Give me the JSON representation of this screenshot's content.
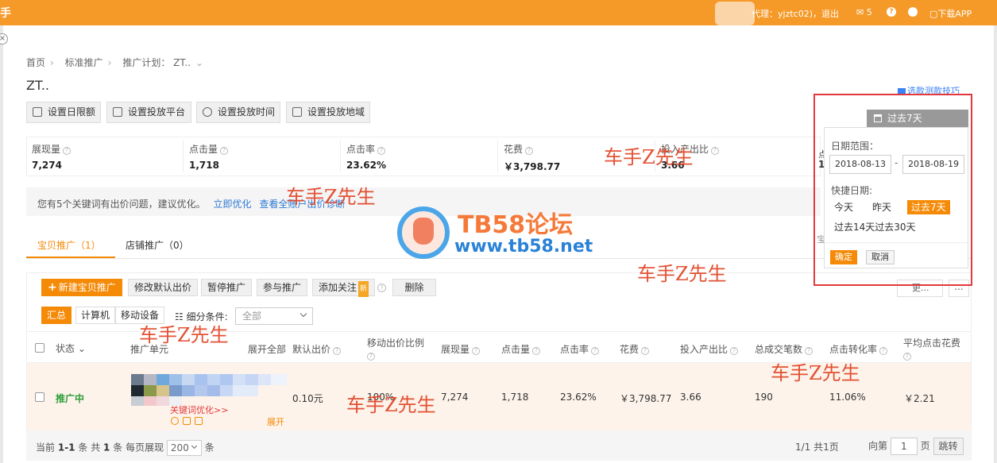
{
  "topbar": {
    "logo_char": "手",
    "agent_text": "代理：yjztc02)，退出",
    "messages": "✉ 5",
    "help": "?",
    "download": "▢下载APP"
  },
  "breadcrumb": [
    "首页",
    "标准推广",
    "推广计划： ZT.."
  ],
  "plan_title": "ZT..",
  "tips_link": "选款测款技巧",
  "settings_buttons": [
    "设置日限额",
    "设置投放平台",
    "设置投放时间",
    "设置投放地域"
  ],
  "stats": [
    {
      "label": "展现量",
      "value": "7,274"
    },
    {
      "label": "点击量",
      "value": "1,718"
    },
    {
      "label": "点击率",
      "value": "23.62%"
    },
    {
      "label": "花费",
      "value": "￥3,798.77"
    },
    {
      "label": "投入产出比",
      "value": "3.66"
    }
  ],
  "stat_behind": {
    "label": "点",
    "value": "1"
  },
  "notice": {
    "text": "您有5个关键词有出价问题，建议优化。",
    "link1": "立即优化",
    "link2": "查看全账户出价诊断"
  },
  "tabs": [
    "宝贝推广（1）",
    "店铺推广（0）"
  ],
  "toolbar": {
    "new": "新建宝贝推广",
    "buttons": [
      "修改默认出价",
      "暂停推广",
      "参与推广",
      "添加关注"
    ],
    "new_badge": "新",
    "delete": "删除",
    "more": "更...",
    "dots": "..."
  },
  "filter": {
    "segments": [
      "汇总",
      "计算机",
      "移动设备"
    ],
    "label": "细分条件:",
    "select": "全部"
  },
  "columns": {
    "status": "状态",
    "unit": "推广单元",
    "expand_all": "展开全部",
    "default_bid": "默认出价",
    "mobile_ratio": "移动出价比例",
    "impressions": "展现量",
    "clicks": "点击量",
    "ctr": "点击率",
    "cost": "花费",
    "roi": "投入产出比",
    "orders": "总成交笔数",
    "cvr": "点击转化率",
    "cpc": "平均点击花费"
  },
  "row": {
    "status": "推广中",
    "kw_opt": "关键词优化>>",
    "expand": "展开",
    "default_bid": "0.10元",
    "mobile_ratio": "100%",
    "impressions": "7,274",
    "clicks": "1,718",
    "ctr": "23.62%",
    "cost": "￥3,798.77",
    "roi": "3.66",
    "orders": "190",
    "cvr": "11.06%",
    "cpc": "￥2.21"
  },
  "pager": {
    "current_prefix": "当前",
    "current_range": "1-1",
    "current_unit": "条",
    "total_prefix": "共",
    "total": "1",
    "total_unit": "条",
    "per_page_label": "每页展现",
    "per_page": "200",
    "per_page_unit": "条",
    "page_info": "1/1",
    "total_pages": "共1页",
    "goto_label": "向第",
    "goto_value": "1",
    "goto_unit": "页",
    "jump": "跳转"
  },
  "date_popover": {
    "range_tab": "过去7天",
    "range_label": "日期范围：",
    "start": "2018-08-13",
    "end": "2018-08-19",
    "dash": "-",
    "quick_label": "快捷日期:",
    "quick": [
      "今天",
      "昨天",
      "过去7天"
    ],
    "quick2": "过去14天过去30天",
    "ok": "确定",
    "cancel": "取消"
  },
  "behind_sort": "宝",
  "watermarks": {
    "text": "车手Z先生",
    "forum_brand": "TB58论坛",
    "forum_url": "www.tb58.net"
  },
  "colors": {
    "accent": "#f58a07",
    "topbar": "#f59a28",
    "link": "#2e7ad4",
    "status_on": "#2e9d3a",
    "highlight_frame": "#e4393c"
  }
}
